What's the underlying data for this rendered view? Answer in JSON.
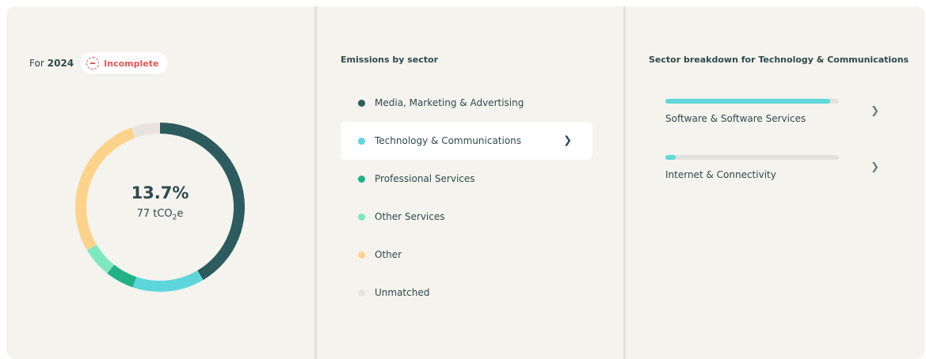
{
  "header": {
    "year_label": "For",
    "year_value": "2024",
    "status": "Incomplete"
  },
  "summary": {
    "percent": "13.7%",
    "amount_prefix": "77 tCO",
    "amount_sub": "2",
    "amount_suffix": "e"
  },
  "sectors": {
    "title": "Emissions by sector",
    "items": [
      {
        "label": "Media, Marketing & Advertising",
        "color": "#2d5b5e"
      },
      {
        "label": "Technology & Communications",
        "color": "#5dd6db",
        "selected": true
      },
      {
        "label": "Professional Services",
        "color": "#21b184"
      },
      {
        "label": "Other Services",
        "color": "#7ee9c0"
      },
      {
        "label": "Other",
        "color": "#fdd38b"
      },
      {
        "label": "Unmatched",
        "color": "#e9e3e0"
      }
    ]
  },
  "breakdown": {
    "title": "Sector breakdown for Technology & Communications",
    "items": [
      {
        "label": "Software & Software Services",
        "fill_fraction": 0.95
      },
      {
        "label": "Internet & Connectivity",
        "fill_fraction": 0.06
      }
    ]
  },
  "chart_data": {
    "type": "pie",
    "variant": "donut",
    "labels": [
      "Media, Marketing & Advertising",
      "Technology & Communications",
      "Professional Services",
      "Other Services",
      "Other",
      "Unmatched"
    ],
    "values": [
      41.5,
      13.7,
      5.5,
      5.8,
      28.0,
      5.5
    ],
    "colors": [
      "#2d5b5e",
      "#5dd6db",
      "#21b184",
      "#7ee9c0",
      "#fdd38b",
      "#e9e3e0"
    ]
  }
}
